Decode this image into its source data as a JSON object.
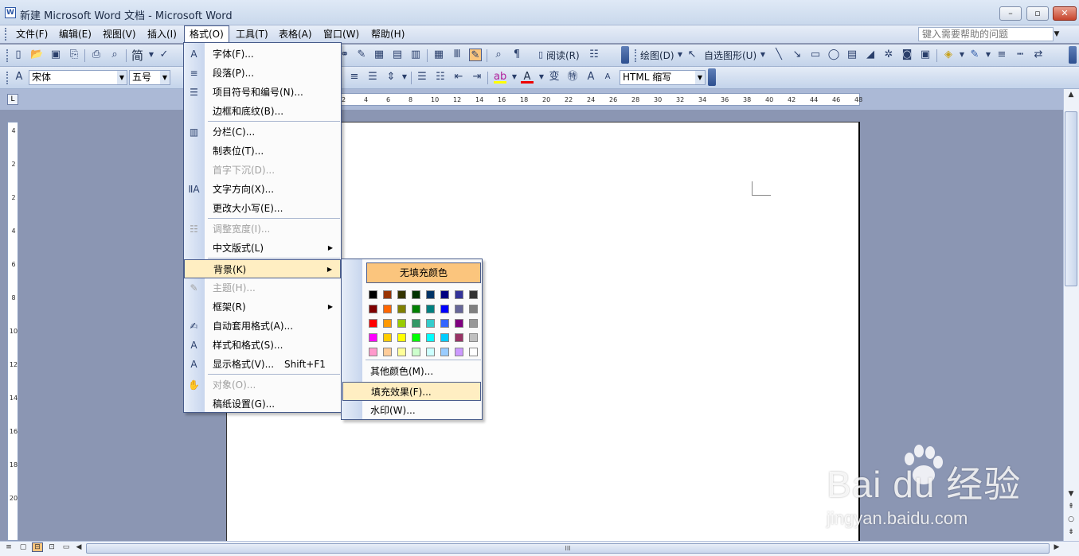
{
  "window": {
    "app_icon": "W",
    "title": "新建 Microsoft Word 文档 - Microsoft Word",
    "buttons": {
      "minimize": "–",
      "restore": "▫",
      "close": "✕"
    }
  },
  "menubar": {
    "items": [
      "文件(F)",
      "编辑(E)",
      "视图(V)",
      "插入(I)",
      "格式(O)",
      "工具(T)",
      "表格(A)",
      "窗口(W)",
      "帮助(H)"
    ],
    "help_placeholder": "键入需要帮助的问题",
    "help_arrow": "▼"
  },
  "toolbar1": {
    "simplified_label": "简",
    "read_label": "阅读(R)",
    "draw_label": "绘图(D)",
    "autoshape_label": "自选图形(U)"
  },
  "toolbar2": {
    "font_name": "宋体",
    "font_size": "五号",
    "style_name": "HTML 缩写"
  },
  "ruler": {
    "h_ticks": [
      "2",
      "4",
      "6",
      "8",
      "10",
      "12",
      "14",
      "16",
      "18",
      "20",
      "22",
      "24",
      "26",
      "28",
      "30",
      "32",
      "34",
      "36",
      "38",
      "40",
      "42",
      "44",
      "46",
      "48"
    ],
    "v_ticks": [
      "4",
      "2",
      "2",
      "4",
      "6",
      "8",
      "10",
      "12",
      "14",
      "16",
      "18",
      "20"
    ],
    "corner_glyph": "L"
  },
  "format_menu": {
    "items": [
      {
        "label": "字体(F)...",
        "icon": "A",
        "enabled": true
      },
      {
        "label": "段落(P)...",
        "icon": "≡",
        "enabled": true
      },
      {
        "label": "项目符号和编号(N)...",
        "icon": "☰",
        "enabled": true
      },
      {
        "label": "边框和底纹(B)...",
        "icon": "",
        "enabled": true
      },
      {
        "label": "分栏(C)...",
        "icon": "▥",
        "enabled": true
      },
      {
        "label": "制表位(T)...",
        "icon": "",
        "enabled": true
      },
      {
        "label": "首字下沉(D)...",
        "icon": "",
        "enabled": false
      },
      {
        "label": "文字方向(X)...",
        "icon": "ⅡA",
        "enabled": true
      },
      {
        "label": "更改大小写(E)...",
        "icon": "",
        "enabled": true
      },
      {
        "label": "调整宽度(I)...",
        "icon": "☷",
        "enabled": false
      },
      {
        "label": "中文版式(L)",
        "icon": "",
        "enabled": true,
        "submenu": true
      },
      {
        "label": "背景(K)",
        "icon": "",
        "enabled": true,
        "submenu": true,
        "highlighted": true
      },
      {
        "label": "主题(H)...",
        "icon": "✎",
        "enabled": false
      },
      {
        "label": "框架(R)",
        "icon": "",
        "enabled": true,
        "submenu": true
      },
      {
        "label": "自动套用格式(A)...",
        "icon": "✍",
        "enabled": true
      },
      {
        "label": "样式和格式(S)...",
        "icon": "A",
        "enabled": true
      },
      {
        "label": "显示格式(V)...",
        "icon": "A",
        "enabled": true,
        "shortcut": "Shift+F1"
      },
      {
        "label": "对象(O)...",
        "icon": "✋",
        "enabled": false
      },
      {
        "label": "稿纸设置(G)...",
        "icon": "",
        "enabled": true
      }
    ],
    "submenu_arrow": "▶"
  },
  "background_menu": {
    "no_fill_label": "无填充颜色",
    "colors": [
      [
        "#000000",
        "#993300",
        "#333300",
        "#003300",
        "#003366",
        "#000080",
        "#333399",
        "#333333"
      ],
      [
        "#800000",
        "#FF6600",
        "#808000",
        "#008000",
        "#008080",
        "#0000FF",
        "#666699",
        "#808080"
      ],
      [
        "#FF0000",
        "#FF9900",
        "#99CC00",
        "#339966",
        "#33CCCC",
        "#3366FF",
        "#800080",
        "#999999"
      ],
      [
        "#FF00FF",
        "#FFCC00",
        "#FFFF00",
        "#00FF00",
        "#00FFFF",
        "#00CCFF",
        "#993366",
        "#C0C0C0"
      ],
      [
        "#FF99CC",
        "#FFCC99",
        "#FFFF99",
        "#CCFFCC",
        "#CCFFFF",
        "#99CCFF",
        "#CC99FF",
        "#FFFFFF"
      ]
    ],
    "more_colors_label": "其他颜色(M)...",
    "fill_effects_label": "填充效果(F)...",
    "watermark_label": "水印(W)..."
  },
  "scrollbar": {
    "up": "▲",
    "down": "▼",
    "left": "◀",
    "right": "▶",
    "grip": "III",
    "prev_page": "⇞",
    "browse": "○",
    "next_page": "⇟"
  },
  "view_buttons": [
    "≡",
    "▢",
    "⊟",
    "⊡"
  ],
  "watermark": {
    "brand": "Bai du 经验",
    "url": "jingyan.baidu.com"
  }
}
